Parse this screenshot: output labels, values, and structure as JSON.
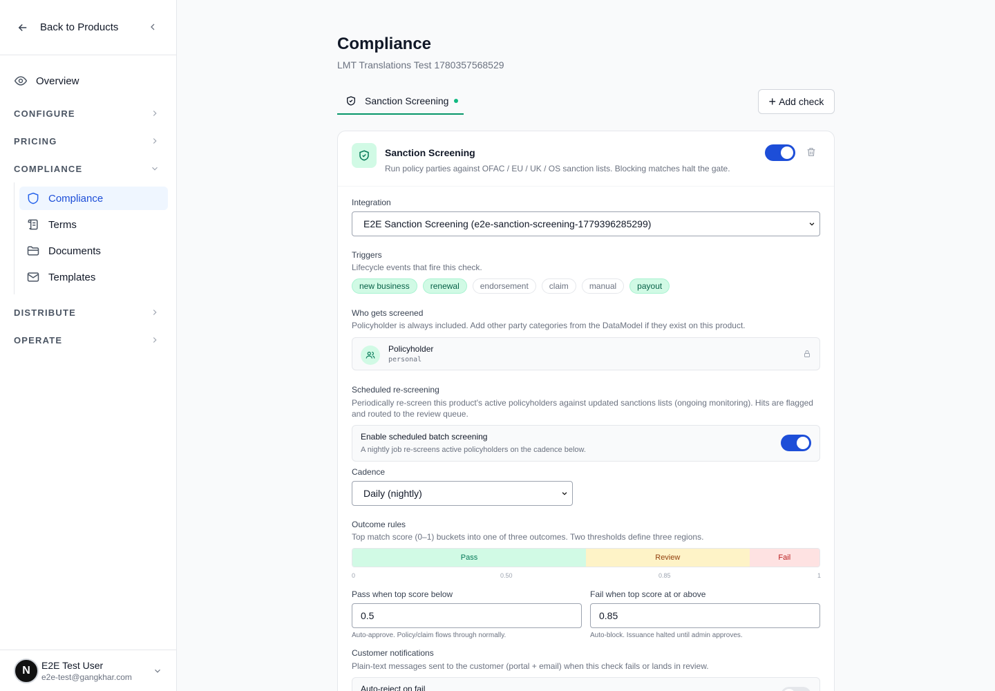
{
  "sidebar": {
    "back_label": "Back to Products",
    "overview_label": "Overview",
    "sections": {
      "configure": "CONFIGURE",
      "pricing": "PRICING",
      "compliance": "COMPLIANCE",
      "distribute": "DISTRIBUTE",
      "operate": "OPERATE"
    },
    "compliance_items": [
      {
        "label": "Compliance",
        "icon": "shield-icon",
        "active": true
      },
      {
        "label": "Terms",
        "icon": "scroll-icon"
      },
      {
        "label": "Documents",
        "icon": "folder-icon"
      },
      {
        "label": "Templates",
        "icon": "mail-icon"
      }
    ],
    "user": {
      "initial": "N",
      "name": "E2E Test User",
      "email": "e2e-test@gangkhar.com"
    }
  },
  "page": {
    "title": "Compliance",
    "subtitle": "LMT Translations Test 1780357568529",
    "tab_label": "Sanction Screening",
    "add_check_label": "Add check"
  },
  "card": {
    "title": "Sanction Screening",
    "description": "Run policy parties against OFAC / EU / UK / OS sanction lists. Blocking matches halt the gate.",
    "enabled": true,
    "integration_label": "Integration",
    "integration_value": "E2E Sanction Screening (e2e-sanction-screening-1779396285299)",
    "triggers_label": "Triggers",
    "triggers_help": "Lifecycle events that fire this check.",
    "triggers": [
      {
        "label": "new business",
        "on": true
      },
      {
        "label": "renewal",
        "on": true
      },
      {
        "label": "endorsement",
        "on": false
      },
      {
        "label": "claim",
        "on": false
      },
      {
        "label": "manual",
        "on": false
      },
      {
        "label": "payout",
        "on": true
      }
    ],
    "who_label": "Who gets screened",
    "who_help": "Policyholder is always included. Add other party categories from the DataModel if they exist on this product.",
    "party_name": "Policyholder",
    "party_type": "personal",
    "rescreen_label": "Scheduled re-screening",
    "rescreen_help": "Periodically re-screen this product's active policyholders against updated sanctions lists (ongoing monitoring). Hits are flagged and routed to the review queue.",
    "batch_title": "Enable scheduled batch screening",
    "batch_desc": "A nightly job re-screens active policyholders on the cadence below.",
    "batch_enabled": true,
    "cadence_label": "Cadence",
    "cadence_value": "Daily (nightly)",
    "outcome_label": "Outcome rules",
    "outcome_help": "Top match score (0–1) buckets into one of three outcomes. Two thresholds define three regions.",
    "bands": {
      "pass": "Pass",
      "review": "Review",
      "fail": "Fail"
    },
    "ticks": {
      "t0": "0",
      "t50": "0.50",
      "t85": "0.85",
      "t1": "1"
    },
    "pass_label": "Pass when top score below",
    "pass_value": "0.5",
    "pass_help": "Auto-approve. Policy/claim flows through normally.",
    "fail_label": "Fail when top score at or above",
    "fail_value": "0.85",
    "fail_help": "Auto-block. Issuance halted until admin approves.",
    "notif_label": "Customer notifications",
    "notif_help": "Plain-text messages sent to the customer (portal + email) when this check fails or lands in review.",
    "auto_reject_label": "Auto-reject on fail"
  }
}
